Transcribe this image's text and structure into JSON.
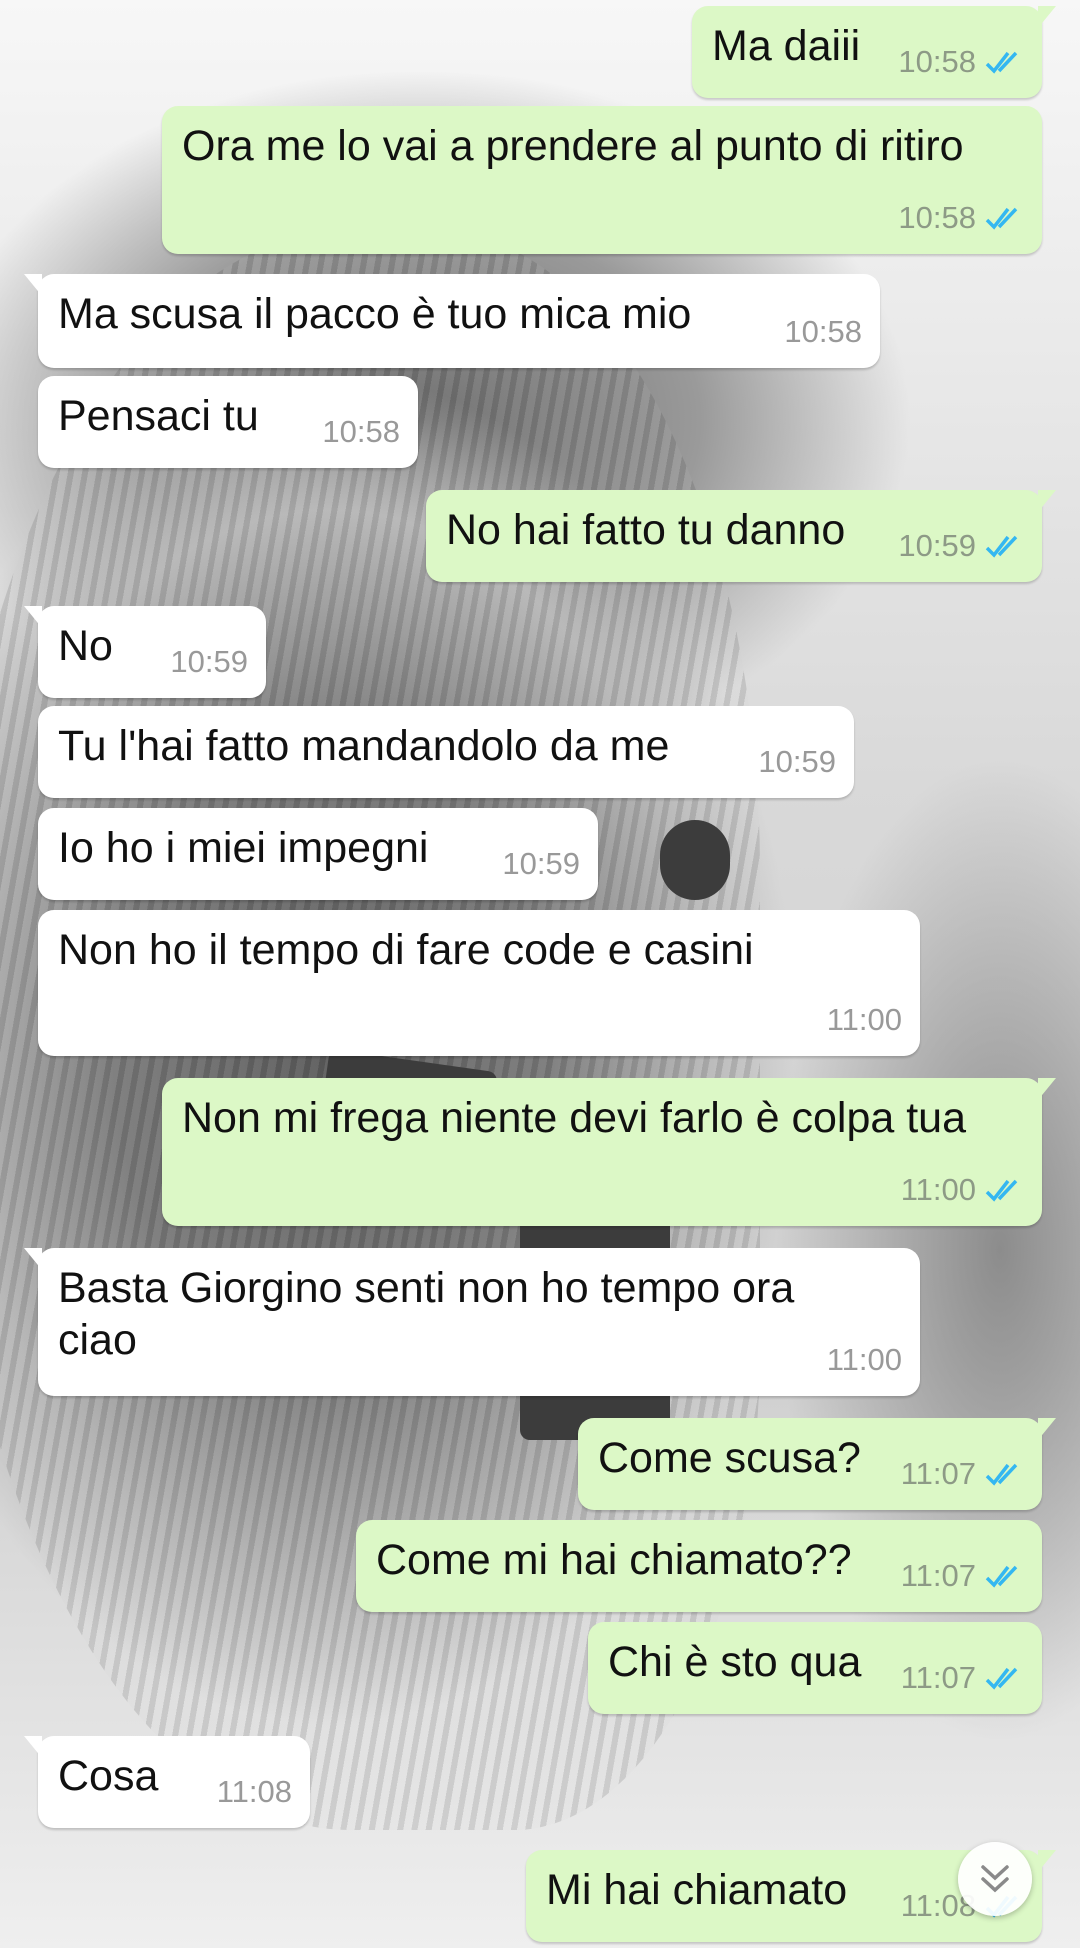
{
  "colors": {
    "incoming_bubble": "#ffffff",
    "outgoing_bubble": "#dcf8c6",
    "read_ticks": "#34b7f1"
  },
  "messages": [
    {
      "dir": "out",
      "text": "Ma daiii",
      "time": "10:58",
      "status": "read-ticks-icon"
    },
    {
      "dir": "out",
      "text": "Ora me lo vai a prendere al punto di ritiro",
      "time": "10:58",
      "status": "read-ticks-icon"
    },
    {
      "dir": "in",
      "text": "Ma scusa il pacco è tuo mica mio",
      "time": "10:58"
    },
    {
      "dir": "in",
      "text": "Pensaci tu",
      "time": "10:58"
    },
    {
      "dir": "out",
      "text": "No hai fatto tu danno",
      "time": "10:59",
      "status": "read-ticks-icon"
    },
    {
      "dir": "in",
      "text": "No",
      "time": "10:59"
    },
    {
      "dir": "in",
      "text": "Tu l'hai fatto mandandolo da me",
      "time": "10:59"
    },
    {
      "dir": "in",
      "text": "Io ho i miei impegni",
      "time": "10:59"
    },
    {
      "dir": "in",
      "text": "Non ho il tempo di fare code e casini",
      "time": "11:00"
    },
    {
      "dir": "out",
      "text": "Non mi frega niente devi farlo è colpa tua",
      "time": "11:00",
      "status": "read-ticks-icon"
    },
    {
      "dir": "in",
      "text": "Basta Giorgino senti non ho tempo ora\nciao",
      "time": "11:00"
    },
    {
      "dir": "out",
      "text": "Come scusa?",
      "time": "11:07",
      "status": "read-ticks-icon"
    },
    {
      "dir": "out",
      "text": "Come mi hai chiamato??",
      "time": "11:07",
      "status": "read-ticks-icon"
    },
    {
      "dir": "out",
      "text": "Chi è sto qua",
      "time": "11:07",
      "status": "read-ticks-icon"
    },
    {
      "dir": "in",
      "text": "Cosa",
      "time": "11:08"
    },
    {
      "dir": "out",
      "text": "Mi hai chiamato",
      "time": "11:08",
      "status": "read-ticks-icon"
    }
  ],
  "scroll_button_icon": "double-chevron-down-icon"
}
